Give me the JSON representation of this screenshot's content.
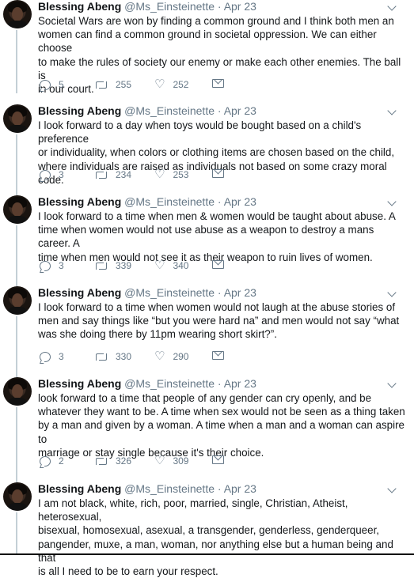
{
  "tweets": [
    {
      "name": "Blessing Abeng",
      "handle": "@Ms_Einsteinette",
      "sep": "·",
      "date": "Apr 23",
      "text": "Societal Wars are won by finding a common ground and I think both men an\nwomen can find a common ground in societal oppression. We can either choose\nto make the rules of society our enemy or make each other enemies. The ball is\nin our court.",
      "replies": "5",
      "retweets": "255",
      "likes": "252"
    },
    {
      "name": "Blessing Abeng",
      "handle": "@Ms_Einsteinette",
      "sep": "·",
      "date": "Apr 23",
      "text": "I look forward to a day when toys would be bought based on a child's preference\nor individuality, when colors or clothing items are chosen based on the child,\nwhere individuals are raised as individuals not based on some crazy moral code.",
      "replies": "3",
      "retweets": "234",
      "likes": "253"
    },
    {
      "name": "Blessing Abeng",
      "handle": "@Ms_Einsteinette",
      "sep": "·",
      "date": "Apr 23",
      "text": "I look forward to a time when men & women would be taught about abuse. A\ntime when women would not use abuse as a weapon to destroy a mans career. A\ntime when men would not see it as their weapon to ruin lives of women.",
      "replies": "3",
      "retweets": "339",
      "likes": "340"
    },
    {
      "name": "Blessing Abeng",
      "handle": "@Ms_Einsteinette",
      "sep": "·",
      "date": "Apr 23",
      "text": "I look forward to a time when women would not laugh at the abuse stories of\nmen and say things like “but you were hard na” and men would not say “what\nwas she doing there by 11pm wearing short skirt?”.",
      "replies": "3",
      "retweets": "330",
      "likes": "290"
    },
    {
      "name": "Blessing Abeng",
      "handle": "@Ms_Einsteinette",
      "sep": "·",
      "date": "Apr 23",
      "text": "look forward to a time that people of any gender can cry openly, and be\nwhatever they want to be. A time when sex would not be seen as a thing taken\nby a man and given by a woman. A time when a man and a woman can aspire to\nmarriage or stay single because it's their choice.",
      "replies": "2",
      "retweets": "326",
      "likes": "309"
    },
    {
      "name": "Blessing Abeng",
      "handle": "@Ms_Einsteinette",
      "sep": "·",
      "date": "Apr 23",
      "text": "I am not black, white, rich, poor, married, single, Christian, Atheist, heterosexual,\nbisexual, homosexual, asexual, a transgender, genderless, genderqueer,\npangender, muxe, a man, woman, nor anything else but a human being and that\nis all I need to be to earn your respect."
    }
  ],
  "icons": {
    "reply": "reply-icon",
    "retweet": "retweet-icon",
    "like": "heart-icon",
    "dm": "envelope-icon",
    "more": "chevron-down-icon"
  },
  "colors": {
    "name": "#14171a",
    "meta": "#657786",
    "thread_line": "#c4cfd6"
  }
}
